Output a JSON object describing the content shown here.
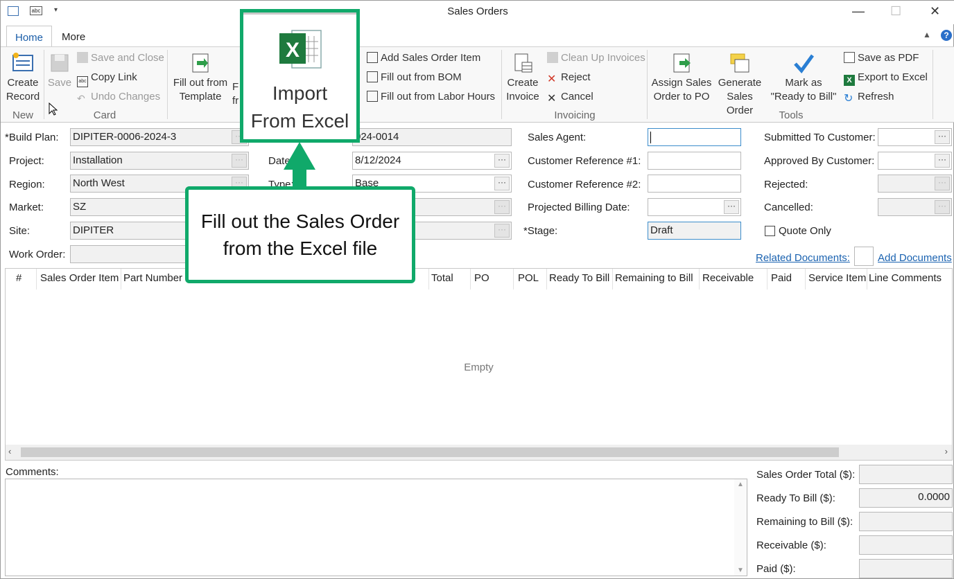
{
  "window": {
    "title": "Sales Orders",
    "min": "—",
    "max": "☐",
    "close": "✕"
  },
  "tabs": [
    {
      "label": "Home"
    },
    {
      "label": "More"
    }
  ],
  "ribbon": {
    "create_record": "Create Record",
    "group_new": "New",
    "save": "Save",
    "save_and_close": "Save and Close",
    "copy_link": "Copy Link",
    "undo_changes": "Undo Changes",
    "group_card": "Card",
    "fill_from_template": "Fill out from Template",
    "fill_from_partial": "F fr",
    "add_sales_order_item": "Add Sales Order Item",
    "fill_from_bom": "Fill out from BOM",
    "fill_from_labor": "Fill out from Labor Hours",
    "create_invoice": "Create Invoice",
    "clean_up_invoices": "Clean Up Invoices",
    "reject": "Reject",
    "cancel": "Cancel",
    "group_invoicing": "Invoicing",
    "assign_sales_order": "Assign Sales Order to PO",
    "generate_sales_order": "Generate Sales Order",
    "mark_ready": "Mark as \"Ready to Bill\"",
    "save_pdf": "Save as PDF",
    "export_excel": "Export to Excel",
    "refresh": "Refresh",
    "group_tools": "Tools"
  },
  "callout_top": {
    "line1": "Import",
    "line2": "From Excel"
  },
  "callout": {
    "line1": "Fill out the Sales Order",
    "line2": "from the Excel file"
  },
  "form": {
    "build_plan_label": "*Build Plan:",
    "build_plan": "DIPITER-0006-2024-3",
    "project_label": "Project:",
    "project": "Installation",
    "region_label": "Region:",
    "region": "North West",
    "market_label": "Market:",
    "market": "SZ",
    "site_label": "Site:",
    "site": "DIPITER",
    "work_order_label": "Work Order:",
    "work_order": "",
    "number": "024-0014",
    "date_label": "Date",
    "date": "8/12/2024",
    "type_label": "Type:",
    "type": "Base",
    "sales_agent_label": "Sales Agent:",
    "sales_agent": "",
    "cust_ref1_label": "Customer Reference #1:",
    "cust_ref1": "",
    "cust_ref2_label": "Customer Reference #2:",
    "cust_ref2": "",
    "proj_billing_label": "Projected Billing Date:",
    "proj_billing": "",
    "stage_label": "*Stage:",
    "stage": "Draft",
    "submitted_label": "Submitted To Customer:",
    "approved_label": "Approved By Customer:",
    "rejected_label": "Rejected:",
    "cancelled_label": "Cancelled:",
    "quote_only_label": "Quote Only",
    "related_docs": "Related Documents:",
    "add_docs": "Add Documents"
  },
  "grid": {
    "columns": [
      "#",
      "Sales Order Item",
      "Part Number",
      "Total",
      "PO",
      "POL",
      "Ready To Bill",
      "Remaining to Bill",
      "Receivable",
      "Paid",
      "Service Item",
      "Line Comments"
    ],
    "empty_text": "Empty"
  },
  "comments": {
    "label": "Comments:",
    "value": ""
  },
  "totals": {
    "sales_order_total_label": "Sales Order Total ($):",
    "sales_order_total": "",
    "ready_to_bill_label": "Ready To Bill ($):",
    "ready_to_bill": "0.0000",
    "remaining_label": "Remaining to Bill ($):",
    "remaining": "",
    "receivable_label": "Receivable ($):",
    "receivable": "",
    "paid_label": "Paid ($):",
    "paid": ""
  },
  "colors": {
    "accent": "#10a96a",
    "link": "#1a62b0",
    "tab_active": "#1a5da8"
  }
}
